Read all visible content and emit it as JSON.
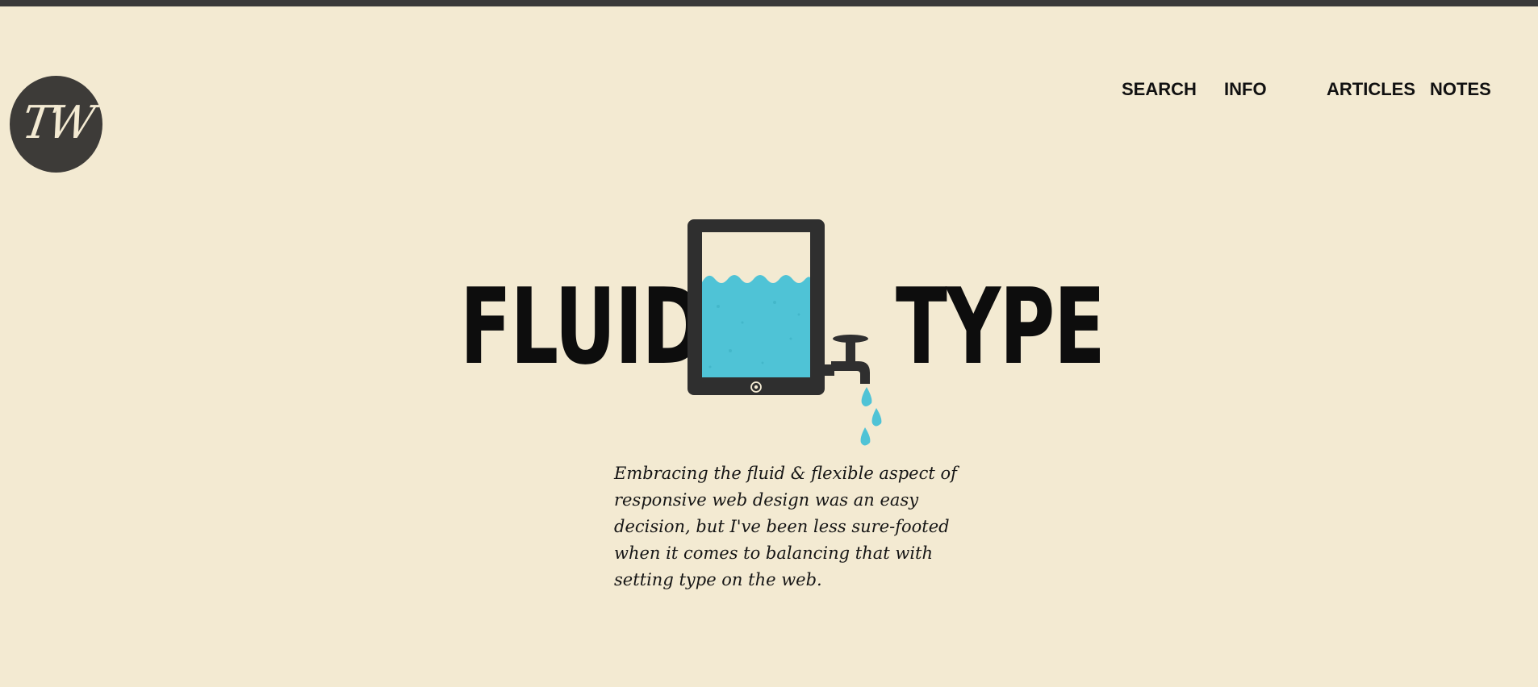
{
  "logo": {
    "monogram": "TW"
  },
  "nav": {
    "items": [
      {
        "label": "SEARCH"
      },
      {
        "label": "INFO"
      },
      {
        "label": "ARTICLES"
      },
      {
        "label": "NOTES"
      }
    ]
  },
  "hero": {
    "word_left": "FLUID",
    "word_right": "TYPE",
    "illustration_icon": "tablet-faucet-icon"
  },
  "intro": {
    "text": "Embracing the fluid & flexible aspect of responsive web design was an easy decision, but I've been less sure-footed when it comes to balancing that with setting type on the web."
  },
  "colors": {
    "background": "#f3ead2",
    "dark": "#3a3a3a",
    "water": "#4fc3d6",
    "text": "#111111"
  }
}
